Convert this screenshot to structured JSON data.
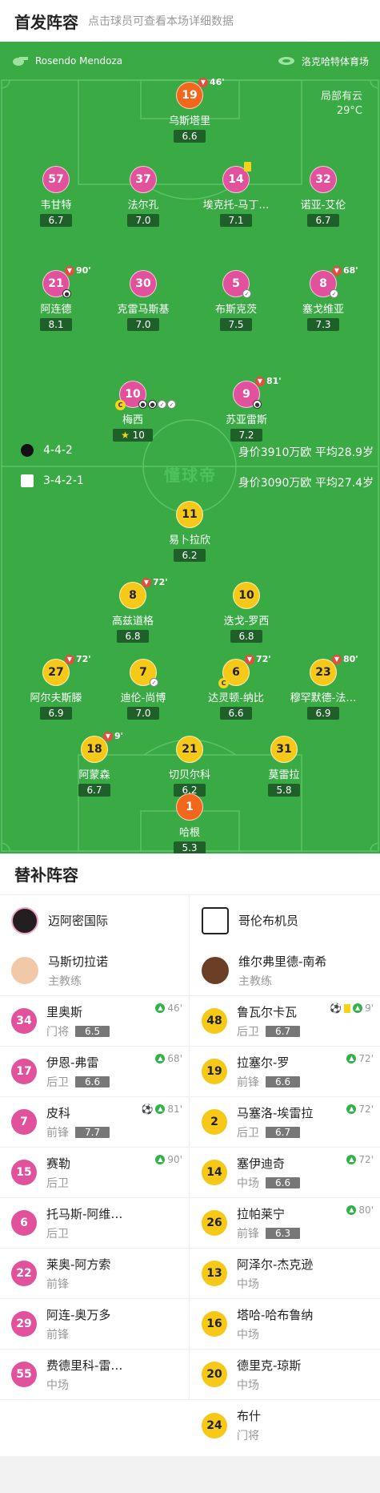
{
  "header": {
    "title": "首发阵容",
    "hint": "点击球员可查看本场详细数据"
  },
  "pitch": {
    "referee": "Rosendo Mendoza",
    "venue": "洛克哈特体育场",
    "weather_line1": "局部有云",
    "weather_line2": "29°C",
    "watermark": "懂球帝",
    "home_formation": "4-4-2",
    "home_value": "身价3910万欧 平均28.9岁",
    "away_formation": "3-4-2-1",
    "away_value": "身价3090万欧 平均27.4岁"
  },
  "home_players": [
    {
      "num": "19",
      "name": "乌斯塔里",
      "rating": "6.6",
      "sub": "46'"
    },
    {
      "num": "57",
      "name": "韦甘特",
      "rating": "6.7"
    },
    {
      "num": "37",
      "name": "法尔孔",
      "rating": "7.0"
    },
    {
      "num": "14",
      "name": "埃克托-马丁…",
      "rating": "7.1"
    },
    {
      "num": "32",
      "name": "诺亚-艾伦",
      "rating": "6.7"
    },
    {
      "num": "21",
      "name": "阿连德",
      "rating": "8.1",
      "sub": "90'"
    },
    {
      "num": "30",
      "name": "克雷马斯基",
      "rating": "7.0"
    },
    {
      "num": "5",
      "name": "布斯克茨",
      "rating": "7.5"
    },
    {
      "num": "8",
      "name": "塞戈维亚",
      "rating": "7.3",
      "sub": "68'"
    },
    {
      "num": "10",
      "name": "梅西",
      "rating": "10"
    },
    {
      "num": "9",
      "name": "苏亚雷斯",
      "rating": "7.2",
      "sub": "81'"
    }
  ],
  "away_players": [
    {
      "num": "11",
      "name": "易卜拉欣",
      "rating": "6.2"
    },
    {
      "num": "8",
      "name": "高兹道格",
      "rating": "6.8",
      "sub": "72'"
    },
    {
      "num": "10",
      "name": "迭戈-罗西",
      "rating": "6.8"
    },
    {
      "num": "27",
      "name": "阿尔夫斯滕",
      "rating": "6.9",
      "sub": "72'"
    },
    {
      "num": "7",
      "name": "迪伦-尚博",
      "rating": "7.0"
    },
    {
      "num": "6",
      "name": "达灵顿-纳比",
      "rating": "6.6",
      "sub": "72'"
    },
    {
      "num": "23",
      "name": "穆罕默德-法…",
      "rating": "6.9",
      "sub": "80'"
    },
    {
      "num": "18",
      "name": "阿蒙森",
      "rating": "6.7",
      "sub": "9'"
    },
    {
      "num": "21",
      "name": "切贝尔科",
      "rating": "6.2"
    },
    {
      "num": "31",
      "name": "莫雷拉",
      "rating": "5.8"
    },
    {
      "num": "1",
      "name": "哈根",
      "rating": "5.3"
    }
  ],
  "subs": {
    "title": "替补阵容",
    "home_team": "迈阿密国际",
    "away_team": "哥伦布机员",
    "home_coach": {
      "name": "马斯切拉诺",
      "role": "主教练"
    },
    "away_coach": {
      "name": "维尔弗里德-南希",
      "role": "主教练"
    },
    "home": [
      {
        "num": "34",
        "name": "里奥斯",
        "pos": "门将",
        "rating": "6.5",
        "min": "46'"
      },
      {
        "num": "17",
        "name": "伊恩-弗雷",
        "pos": "后卫",
        "rating": "6.6",
        "min": "68'"
      },
      {
        "num": "7",
        "name": "皮科",
        "pos": "前锋",
        "rating": "7.7",
        "min": "81'"
      },
      {
        "num": "15",
        "name": "赛勒",
        "pos": "后卫",
        "rating": "",
        "min": "90'"
      },
      {
        "num": "6",
        "name": "托马斯-阿维…",
        "pos": "后卫",
        "rating": "",
        "min": ""
      },
      {
        "num": "22",
        "name": "莱奥-阿方索",
        "pos": "前锋",
        "rating": "",
        "min": ""
      },
      {
        "num": "29",
        "name": "阿连-奥万多",
        "pos": "前锋",
        "rating": "",
        "min": ""
      },
      {
        "num": "55",
        "name": "费德里科-雷…",
        "pos": "中场",
        "rating": "",
        "min": ""
      }
    ],
    "away": [
      {
        "num": "48",
        "name": "鲁瓦尔卡瓦",
        "pos": "后卫",
        "rating": "6.7",
        "min": "9'"
      },
      {
        "num": "19",
        "name": "拉塞尔-罗",
        "pos": "前锋",
        "rating": "6.6",
        "min": "72'"
      },
      {
        "num": "2",
        "name": "马塞洛-埃雷拉",
        "pos": "后卫",
        "rating": "6.7",
        "min": "72'"
      },
      {
        "num": "14",
        "name": "塞伊迪奇",
        "pos": "中场",
        "rating": "6.6",
        "min": "72'"
      },
      {
        "num": "26",
        "name": "拉帕莱宁",
        "pos": "前锋",
        "rating": "6.3",
        "min": "80'"
      },
      {
        "num": "13",
        "name": "阿泽尔-杰克逊",
        "pos": "中场",
        "rating": "",
        "min": ""
      },
      {
        "num": "16",
        "name": "塔哈-哈布鲁纳",
        "pos": "中场",
        "rating": "",
        "min": ""
      },
      {
        "num": "20",
        "name": "德里克-琼斯",
        "pos": "中场",
        "rating": "",
        "min": ""
      },
      {
        "num": "24",
        "name": "布什",
        "pos": "门将",
        "rating": "",
        "min": ""
      }
    ]
  },
  "colors": {
    "pitch": "#3aaa45",
    "home": "#e2519c",
    "away": "#f6c817"
  }
}
